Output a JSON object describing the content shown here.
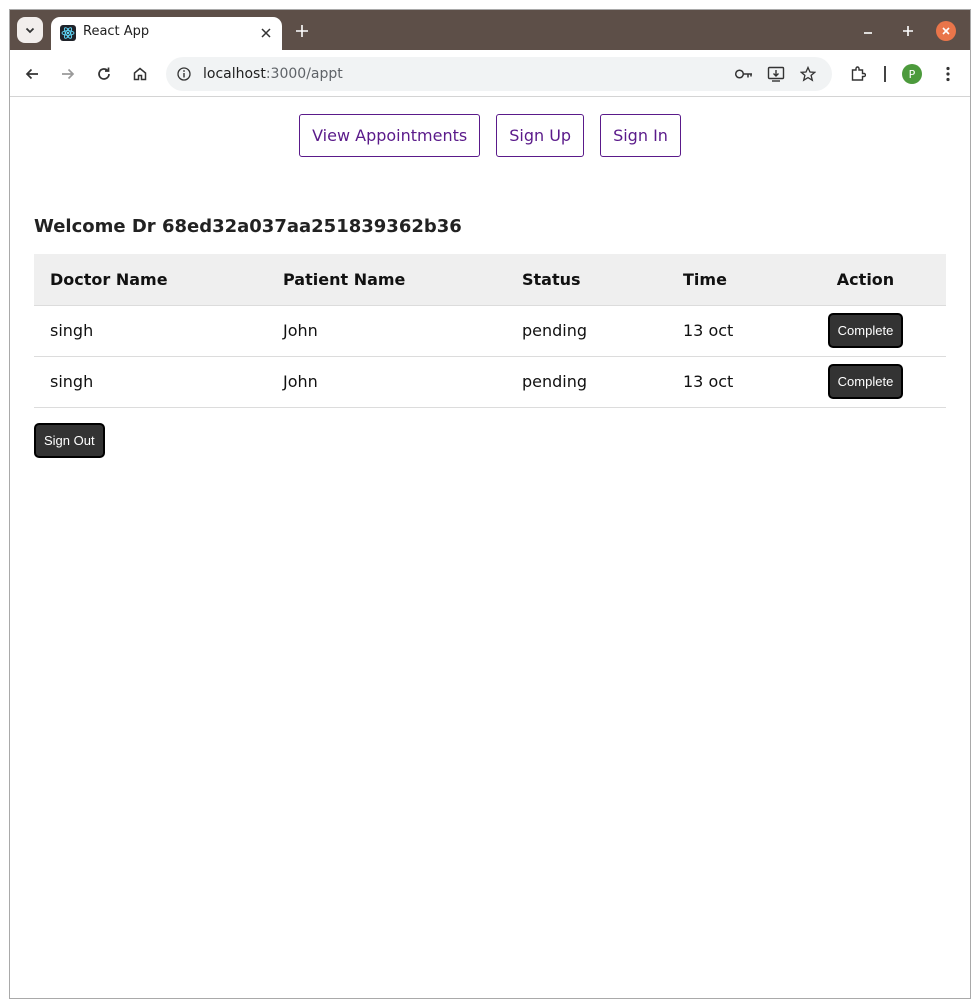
{
  "browser": {
    "tab_title": "React App",
    "url_host": "localhost",
    "url_path": ":3000/appt",
    "profile_initial": "P"
  },
  "nav": {
    "items": [
      "View Appointments",
      "Sign Up",
      "Sign In"
    ]
  },
  "welcome": "Welcome Dr 68ed32a037aa251839362b36",
  "table": {
    "headers": [
      "Doctor Name",
      "Patient Name",
      "Status",
      "Time",
      "Action"
    ],
    "rows": [
      {
        "doctor": "singh",
        "patient": "John",
        "status": "pending",
        "time": "13 oct",
        "action": "Complete"
      },
      {
        "doctor": "singh",
        "patient": "John",
        "status": "pending",
        "time": "13 oct",
        "action": "Complete"
      }
    ]
  },
  "sign_out_label": "Sign Out",
  "colors": {
    "titlebar": "#5d4f48",
    "nav_accent": "#5a1a8a",
    "button_dark": "#333333",
    "close_button": "#e9754a"
  }
}
